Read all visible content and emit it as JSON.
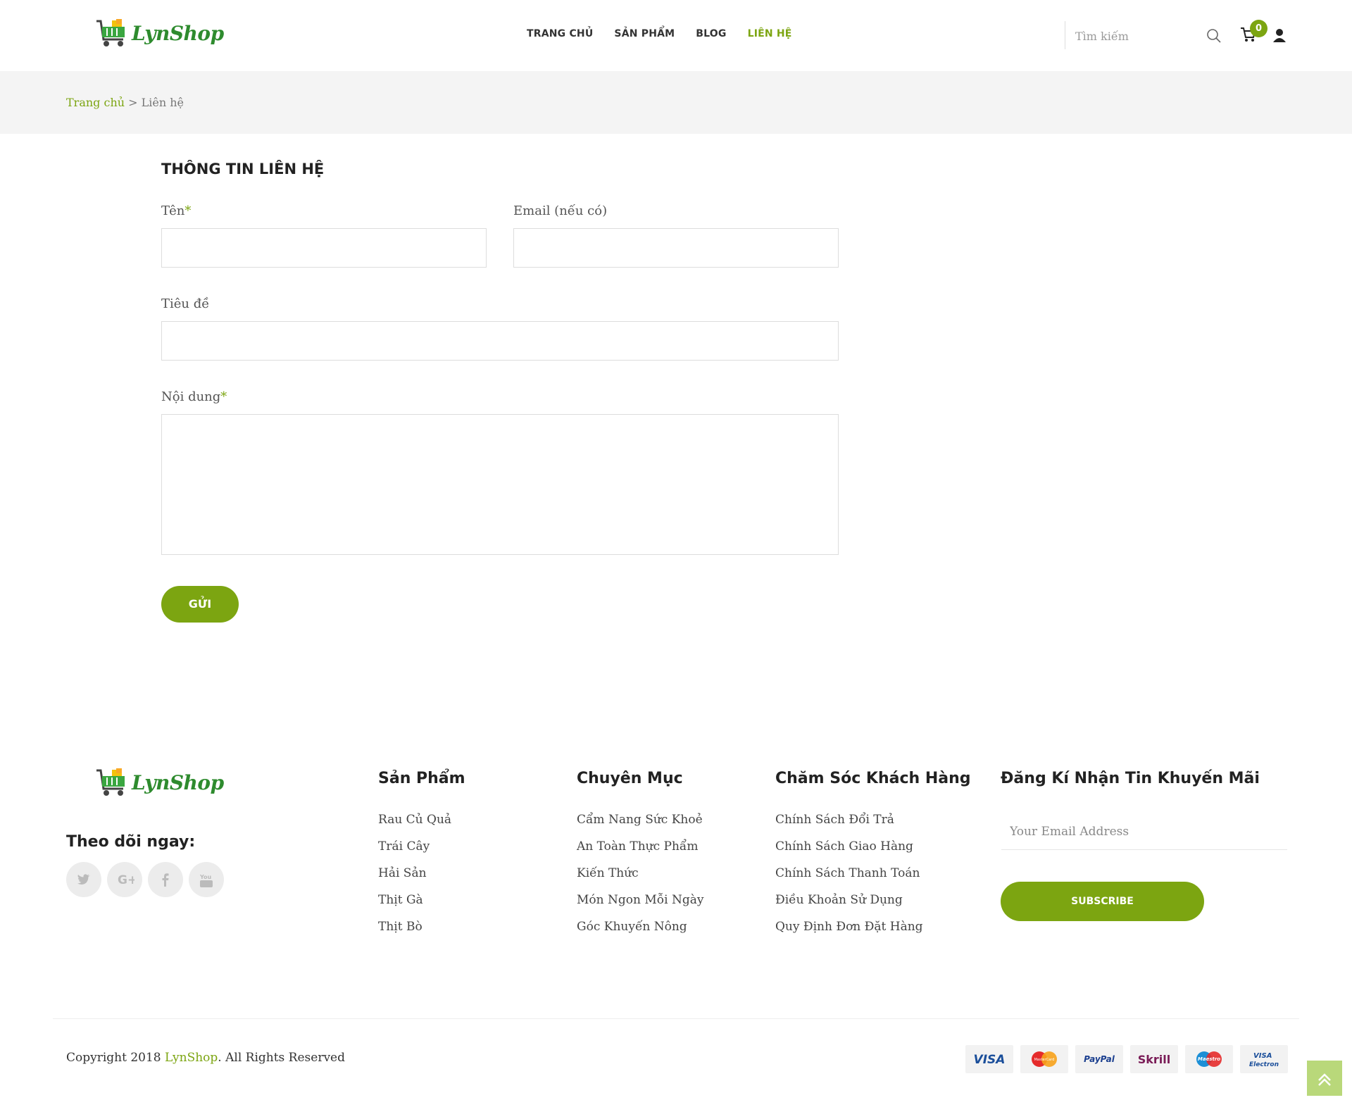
{
  "header": {
    "logo_text": "LynShop",
    "nav": [
      "TRANG CHỦ",
      "SẢN PHẨM",
      "BLOG",
      "LIÊN HỆ"
    ],
    "search_placeholder": "Tìm kiếm",
    "cart_count": "0"
  },
  "breadcrumb": {
    "home": "Trang chủ",
    "separator": " > ",
    "current": "Liên hệ"
  },
  "form": {
    "title": "THÔNG TIN LIÊN HỆ",
    "name_label": "Tên",
    "email_label": "Email (nếu có)",
    "subject_label": "Tiêu đề",
    "content_label": "Nội dung",
    "required_mark": "*",
    "submit": "GỬI"
  },
  "footer": {
    "logo_text": "LynShop",
    "follow_label": "Theo dõi ngay:",
    "columns": [
      {
        "title": "Sản Phẩm",
        "items": [
          "Rau Củ Quả",
          "Trái Cây",
          "Hải Sản",
          "Thịt Gà",
          "Thịt Bò"
        ]
      },
      {
        "title": "Chuyên Mục",
        "items": [
          "Cẩm Nang Sức Khoẻ",
          "An Toàn Thực Phẩm",
          "Kiến Thức",
          "Món Ngon Mỗi Ngày",
          "Góc Khuyến Nông"
        ]
      },
      {
        "title": "Chăm Sóc Khách Hàng",
        "items": [
          "Chính Sách Đổi Trả",
          "Chính Sách Giao Hàng",
          "Chính Sách Thanh Toán",
          "Điều Khoản Sử Dụng",
          "Quy Định Đơn Đặt Hàng"
        ]
      }
    ],
    "newsletter": {
      "title": "Đăng Kí Nhận Tin Khuyến Mãi",
      "placeholder": "Your Email Address",
      "button": "SUBSCRIBE"
    },
    "copyright_prefix": "Copyright 2018 ",
    "copyright_brand": "LynShop",
    "copyright_suffix": ". All Rights Reserved",
    "payments": [
      "VISA",
      "MasterCard",
      "PayPal",
      "Skrill",
      "Maestro",
      "VISA Electron"
    ],
    "social_icons": [
      "twitter-icon",
      "google-plus-icon",
      "facebook-icon",
      "youtube-icon"
    ]
  },
  "colors": {
    "accent": "#7ca511",
    "logo": "#2e8b2e",
    "breadcrumb_bg": "#f4f4f4"
  }
}
